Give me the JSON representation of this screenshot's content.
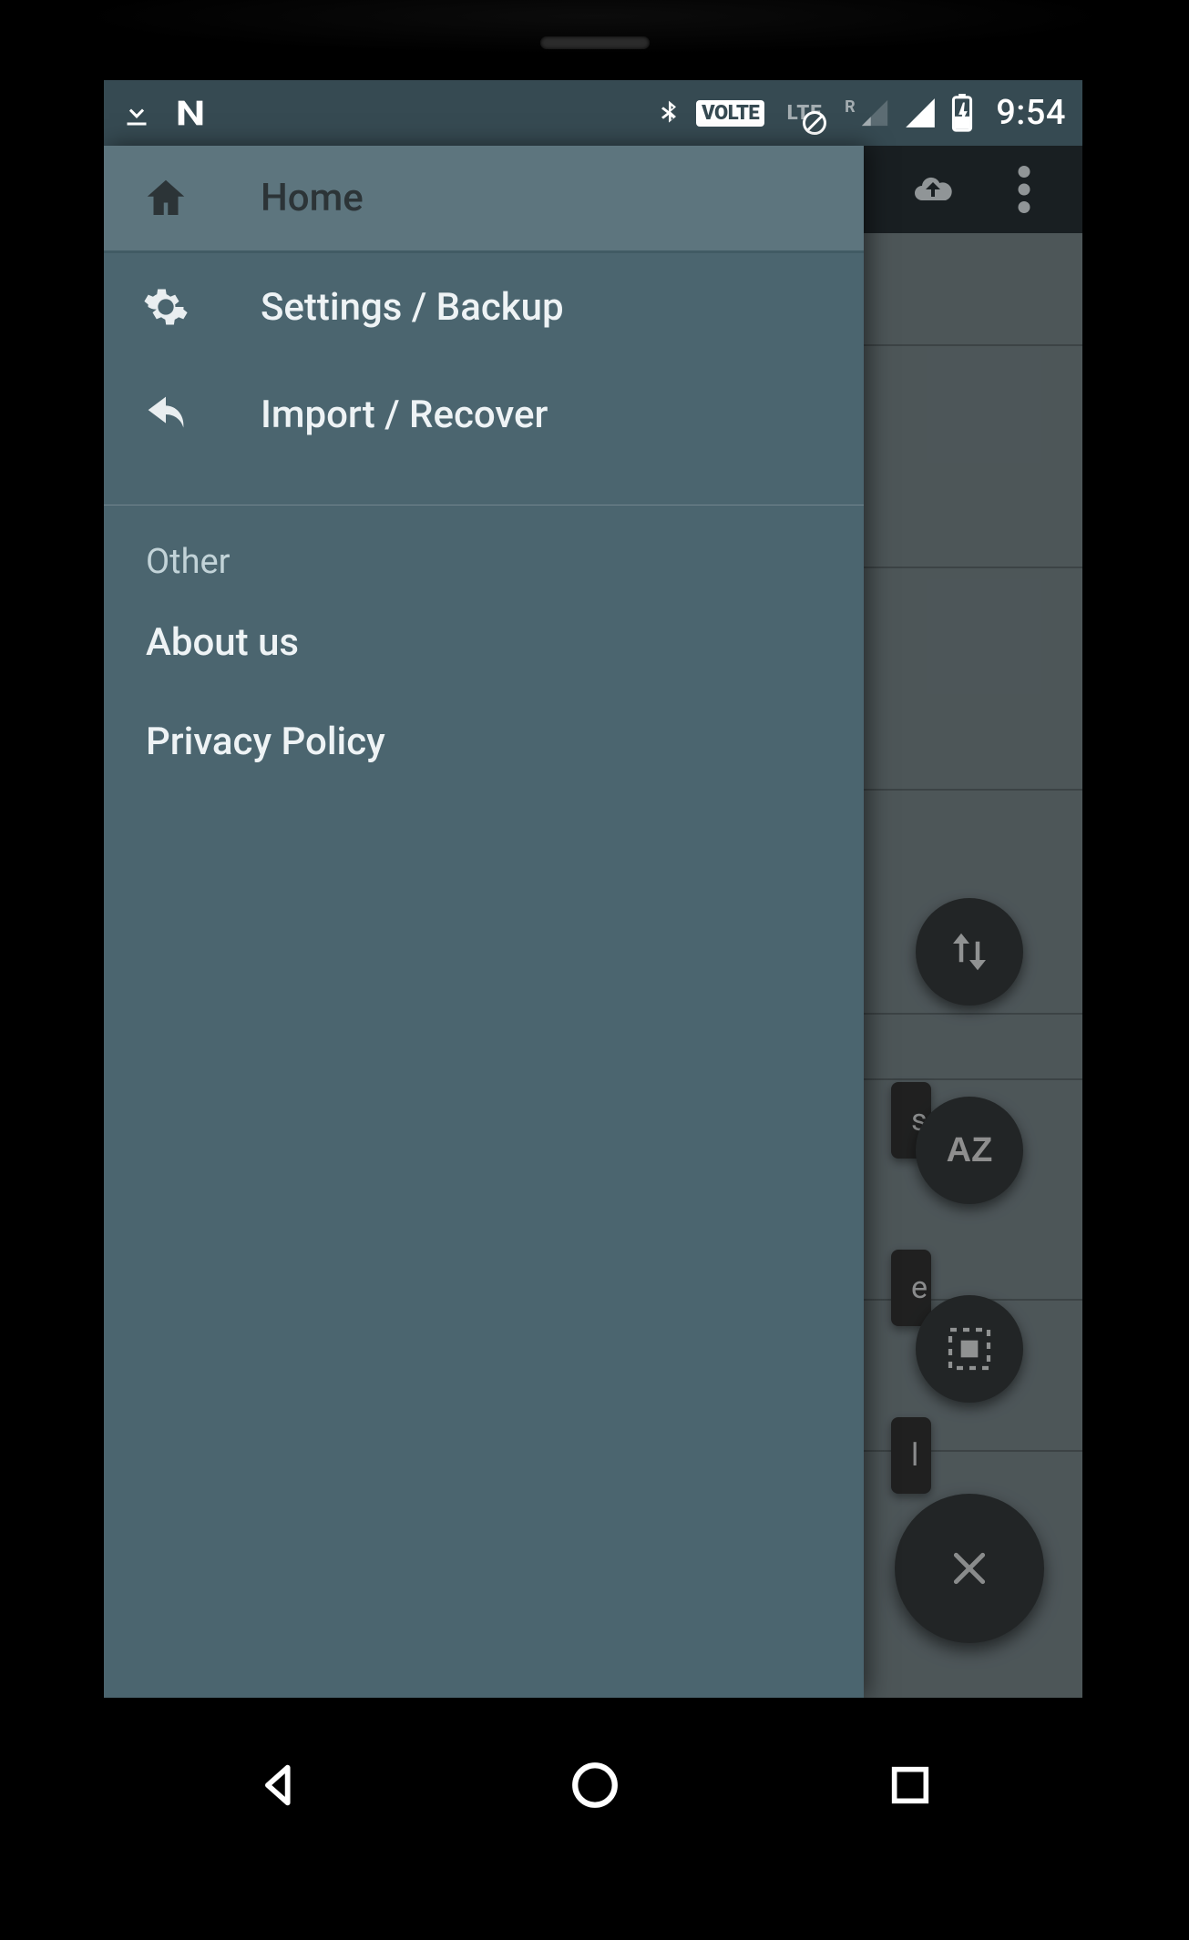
{
  "status_bar": {
    "clock": "9:54",
    "volte_label": "VOLTE",
    "lte_label": "LTE",
    "roaming_label": "R",
    "icons_left": [
      "download",
      "android-n"
    ],
    "icons_right": [
      "bluetooth",
      "volte",
      "lte-disabled",
      "signal-roaming-weak",
      "signal-full",
      "battery-charging"
    ]
  },
  "toolbar": {
    "actions": [
      "cloud-upload",
      "more-vert"
    ]
  },
  "drawer": {
    "items": [
      {
        "icon": "home",
        "label": "Home",
        "selected": true
      },
      {
        "icon": "gear",
        "label": "Settings / Backup",
        "selected": false
      },
      {
        "icon": "undo",
        "label": "Import / Recover",
        "selected": false
      }
    ],
    "section_label": "Other",
    "links": [
      {
        "label": "About us"
      },
      {
        "label": "Privacy Policy"
      }
    ]
  },
  "fab": {
    "mini": [
      {
        "icon": "swap-vertical",
        "chip_label": "s"
      },
      {
        "icon": "az",
        "chip_label": "e"
      },
      {
        "icon": "select-all",
        "chip_label": "l"
      }
    ],
    "main": {
      "icon": "close"
    }
  },
  "system_nav": {
    "buttons": [
      "back",
      "home",
      "recents"
    ]
  },
  "colors": {
    "drawer_bg": "#4b656f",
    "drawer_selected_bg": "#5d757e",
    "status_bg": "#364a52",
    "toolbar_bg": "#252d31",
    "fab_bg": "#323637"
  }
}
